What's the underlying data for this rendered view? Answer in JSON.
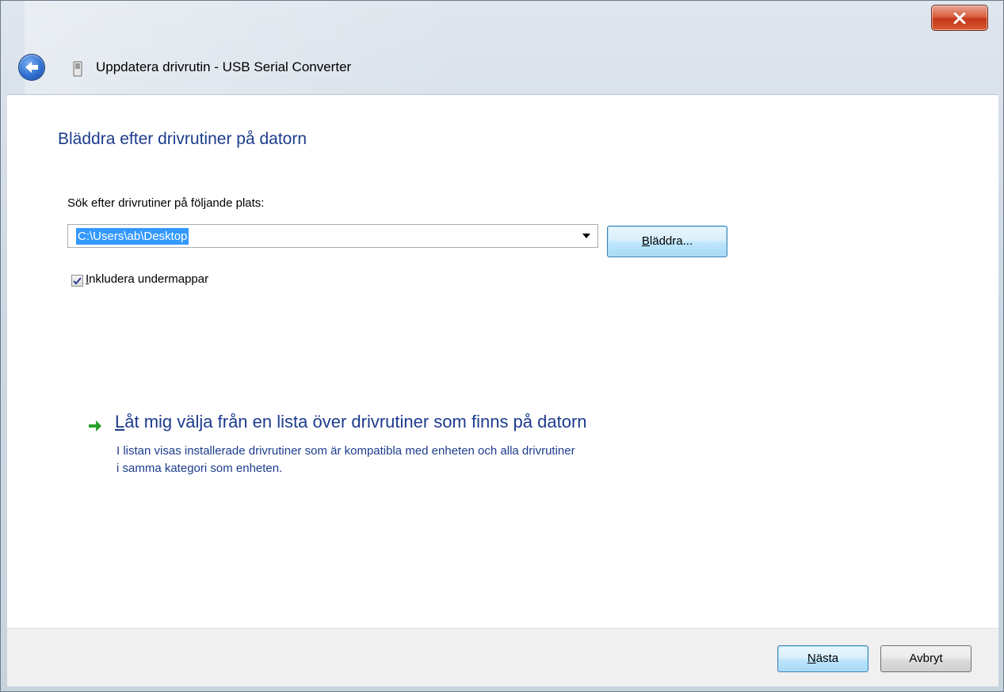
{
  "window": {
    "title": "Uppdatera drivrutin - USB Serial Converter"
  },
  "content": {
    "heading": "Bläddra efter drivrutiner på datorn",
    "location_label": "Sök efter drivrutiner på följande plats:",
    "path_value": "C:\\Users\\ab\\Desktop",
    "browse": {
      "accel": "B",
      "rest": "läddra..."
    },
    "include_subfolders": {
      "checked": true,
      "accel": "I",
      "rest": "nkludera undermappar"
    },
    "option": {
      "link_accel": "L",
      "link_rest": "åt mig välja från en lista över drivrutiner som finns på datorn",
      "desc_line1": "I listan visas installerade drivrutiner som är kompatibla med enheten och alla drivrutiner",
      "desc_line2": "i samma kategori som enheten."
    }
  },
  "footer": {
    "next": {
      "accel": "N",
      "rest": "ästa"
    },
    "cancel": "Avbryt"
  },
  "icons": {
    "back": "back-arrow-icon",
    "device": "usb-device-icon",
    "close": "close-icon",
    "option_arrow": "green-arrow-icon",
    "dropdown": "chevron-down-icon",
    "check": "checkmark-icon"
  },
  "colors": {
    "heading": "#1c3c8d",
    "selection": "#3399ff",
    "close": "#c4381b"
  }
}
